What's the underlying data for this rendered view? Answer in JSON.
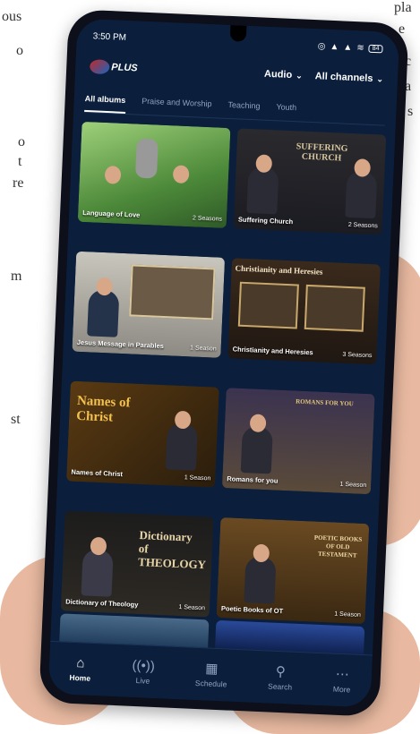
{
  "status_bar": {
    "time": "3:50 PM",
    "battery": "84"
  },
  "header": {
    "logo_text": "PLUS",
    "audio_label": "Audio",
    "channels_label": "All channels"
  },
  "tabs": [
    {
      "label": "All albums",
      "active": true
    },
    {
      "label": "Praise and Worship"
    },
    {
      "label": "Teaching"
    },
    {
      "label": "Youth"
    }
  ],
  "albums": [
    {
      "title": "Language of Love",
      "seasons": "2 Seasons"
    },
    {
      "title": "Suffering Church",
      "seasons": "2 Seasons"
    },
    {
      "title": "Jesus Message in Parables",
      "seasons": "1 Season"
    },
    {
      "title": "Christianity and Heresies",
      "seasons": "3 Seasons"
    },
    {
      "title": "Names of Christ",
      "seasons": "1 Season"
    },
    {
      "title": "Romans for you",
      "seasons": "1 Season"
    },
    {
      "title": "Dictionary of Theology",
      "seasons": "1 Season"
    },
    {
      "title": "Poetic Books of OT",
      "seasons": "1 Season"
    }
  ],
  "art_text": {
    "suffering": "SUFFERING CHURCH",
    "heresies": "Christianity and Heresies",
    "names": "Names of Christ",
    "romans": "ROMANS FOR YOU",
    "dictionary": "Dictionary of THEOLOGY",
    "poetic": "POETIC BOOKS OF OLD TESTAMENT"
  },
  "nav": [
    {
      "label": "Home",
      "icon": "home-icon",
      "active": true
    },
    {
      "label": "Live",
      "icon": "live-icon"
    },
    {
      "label": "Schedule",
      "icon": "schedule-icon"
    },
    {
      "label": "Search",
      "icon": "search-icon"
    },
    {
      "label": "More",
      "icon": "more-icon"
    }
  ],
  "colors": {
    "screen_bg": "#0b1f3c",
    "accent": "#ffffff",
    "muted": "#8fa3bf"
  }
}
